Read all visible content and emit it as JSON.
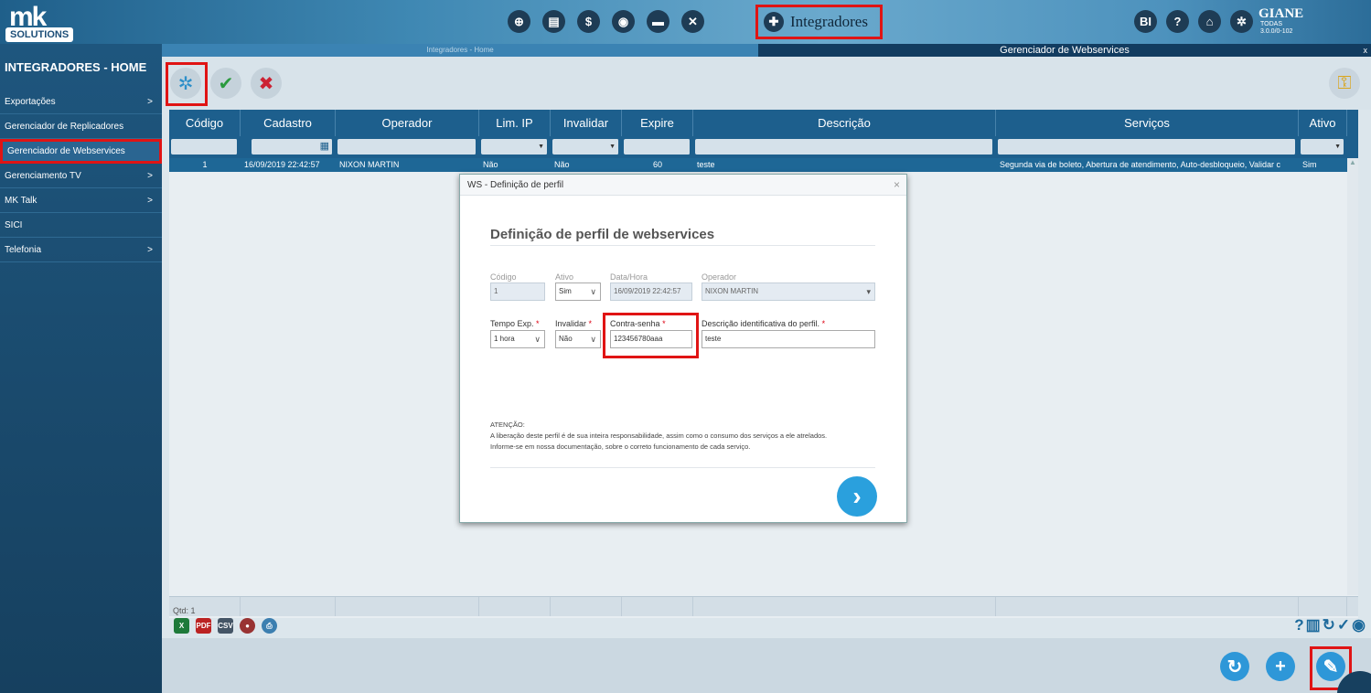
{
  "header": {
    "logo_text": "mk",
    "logo_sub": "SOLUTIONS",
    "module_label": "Integradores",
    "user_name": "GIANE",
    "user_line1": "TODAS",
    "user_line2": "3.0.0/0-102",
    "bi_label": "BI",
    "help_label": "?"
  },
  "sidebar": {
    "title": "INTEGRADORES - HOME",
    "items": [
      {
        "label": "Exportações",
        "chevron": ">"
      },
      {
        "label": "Gerenciador de Replicadores",
        "chevron": ""
      },
      {
        "label": "Gerenciador de Webservices",
        "chevron": ""
      },
      {
        "label": "Gerenciamento TV",
        "chevron": ">"
      },
      {
        "label": "MK Talk",
        "chevron": ">"
      },
      {
        "label": "SICI",
        "chevron": ""
      },
      {
        "label": "Telefonia",
        "chevron": ">"
      }
    ]
  },
  "tabs": {
    "left": "Integradores - Home",
    "right": "Gerenciador de Webservices",
    "close": "x"
  },
  "grid": {
    "columns": [
      "Código",
      "Cadastro",
      "Operador",
      "Lim. IP",
      "Invalidar",
      "Expire",
      "Descrição",
      "Serviços",
      "Ativo"
    ],
    "row": [
      "1",
      "16/09/2019 22:42:57",
      "NIXON MARTIN",
      "Não",
      "Não",
      "60",
      "teste",
      "Segunda via de boleto, Abertura de atendimento, Auto-desbloqueio, Validar c",
      "Sim"
    ],
    "footer_count": "Qtd: 1"
  },
  "modal": {
    "window_title": "WS - Definição de perfil",
    "close": "×",
    "heading": "Definição de perfil de webservices",
    "codigo_label": "Código",
    "codigo_value": "1",
    "ativo_label": "Ativo",
    "ativo_value": "Sim",
    "datahora_label": "Data/Hora",
    "datahora_value": "16/09/2019 22:42:57",
    "operador_label": "Operador",
    "operador_value": "NIXON MARTIN",
    "tempo_label": "Tempo Exp.",
    "tempo_value": "1 hora",
    "invalidar_label": "Invalidar",
    "invalidar_value": "Não",
    "contrasenha_label": "Contra-senha",
    "contrasenha_value": "123456780aaa",
    "descricao_label": "Descrição identificativa do perfil.",
    "descricao_value": "teste",
    "required_mark": "*",
    "attention_title": "ATENÇÃO:",
    "attention_line1": "A liberação deste perfil é de sua inteira responsabilidade, assim como o consumo dos serviços a ele atrelados.",
    "attention_line2": "Informe-se em nossa documentação, sobre o correto funcionamento de cada serviço."
  },
  "exports": [
    "X",
    "PDF",
    "CSV"
  ]
}
